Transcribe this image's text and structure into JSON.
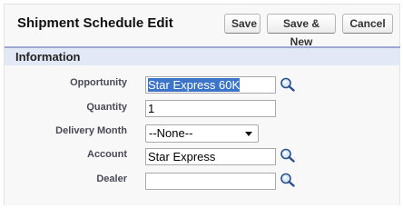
{
  "page": {
    "title": "Shipment Schedule Edit"
  },
  "buttons": {
    "save": "Save",
    "save_new": "Save & New",
    "cancel": "Cancel"
  },
  "section": {
    "title": "Information"
  },
  "fields": {
    "opportunity": {
      "label": "Opportunity",
      "value": "Star Express 60K"
    },
    "quantity": {
      "label": "Quantity",
      "value": "1"
    },
    "delivery_month": {
      "label": "Delivery Month",
      "value": "--None--"
    },
    "account": {
      "label": "Account",
      "value": "Star Express"
    },
    "dealer": {
      "label": "Dealer",
      "value": ""
    }
  },
  "icons": {
    "lookup": "magnifier-lookup-icon",
    "dropdown": "chevron-down-icon"
  },
  "colors": {
    "section_bar": "#e2e8f5",
    "section_border": "#9ea9d1",
    "selection": "#3b74c8"
  }
}
